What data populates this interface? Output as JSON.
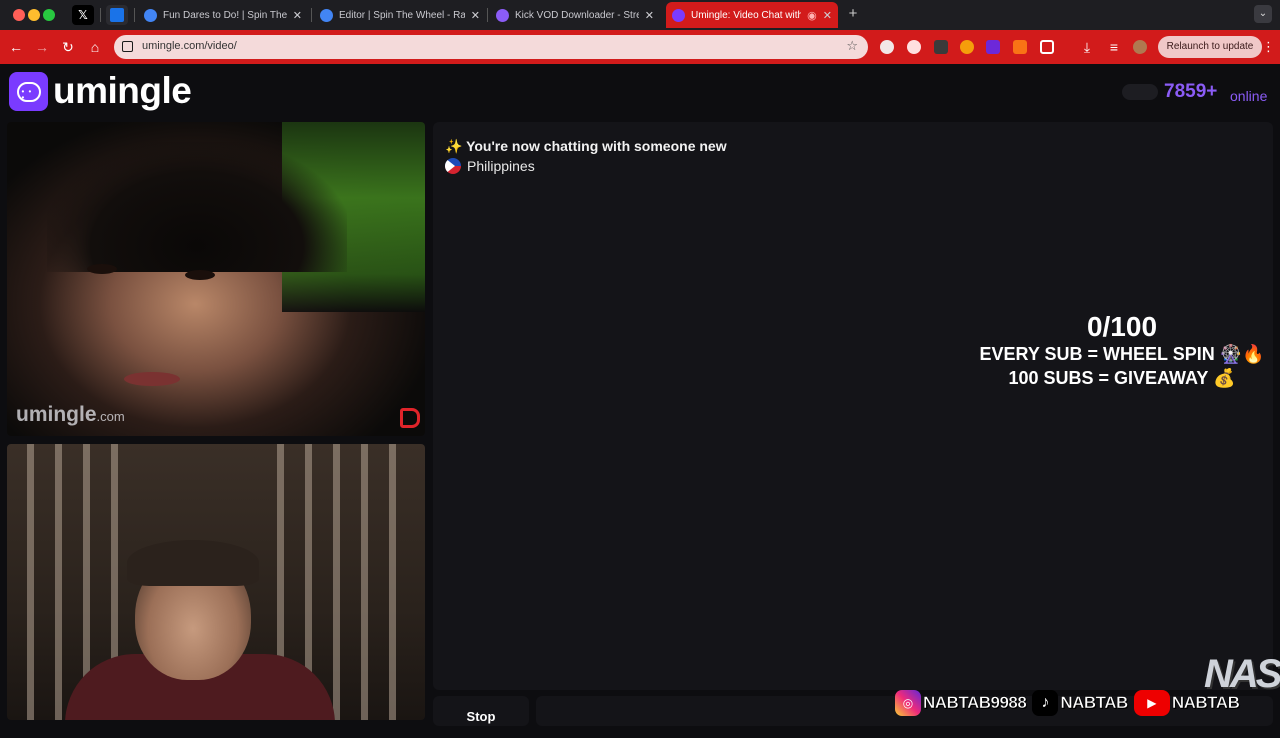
{
  "browser": {
    "tabs": [
      {
        "label": "Fun Dares to Do! | Spin The W",
        "active": false
      },
      {
        "label": "Editor | Spin The Wheel - Ran",
        "active": false
      },
      {
        "label": "Kick VOD Downloader - Strea",
        "active": false
      },
      {
        "label": "Umingle: Video Chat with",
        "active": true
      }
    ],
    "pinned": [
      "x-icon",
      "document-icon"
    ],
    "new_tab_symbol": "+",
    "url": "umingle.com/video/",
    "relaunch_label": "Relaunch to update",
    "accent_color": "#d21b1b"
  },
  "header": {
    "brand": "umingle",
    "online_count": "7859+",
    "online_label": "online",
    "brand_color": "#7a3bff"
  },
  "stranger_video": {
    "watermark": "umingle",
    "watermark_suffix": ".com"
  },
  "chat": {
    "status_message": "✨ You're now chatting with someone new",
    "country": "Philippines"
  },
  "overlay": {
    "counter": "0/100",
    "line1": "EVERY SUB = WHEEL SPIN 🎡🔥",
    "line2": "100 SUBS = GIVEAWAY 💰"
  },
  "controls": {
    "stop_label": "Stop"
  },
  "socials": [
    {
      "platform": "instagram-icon",
      "handle": "NABTAB9988"
    },
    {
      "platform": "tiktok-icon",
      "handle": "NABTAB"
    },
    {
      "platform": "youtube-icon",
      "handle": "NABTAB"
    }
  ],
  "streamer_logo": "NAS"
}
